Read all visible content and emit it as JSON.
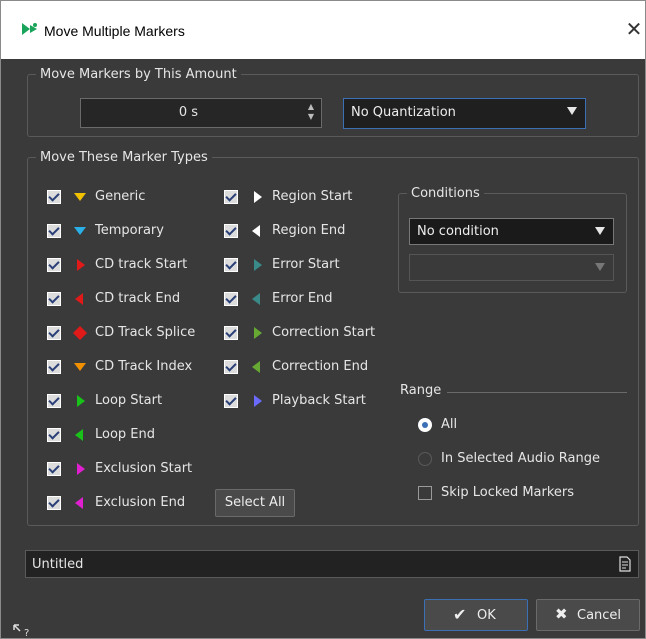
{
  "window": {
    "title": "Move Multiple Markers",
    "close_glyph": "✕"
  },
  "move_amount": {
    "legend": "Move Markers by This Amount",
    "value": "0 s",
    "quantization": "No Quantization"
  },
  "marker_types": {
    "legend": "Move These Marker Types",
    "column1": [
      {
        "label": "Generic",
        "checked": true,
        "icon": "generic-marker-icon",
        "color": "#f2c200"
      },
      {
        "label": "Temporary",
        "checked": true,
        "icon": "temporary-marker-icon",
        "color": "#2ab0e6"
      },
      {
        "label": "CD track Start",
        "checked": true,
        "icon": "cd-track-start-icon",
        "color": "#e01919"
      },
      {
        "label": "CD track End",
        "checked": true,
        "icon": "cd-track-end-icon",
        "color": "#e01919"
      },
      {
        "label": "CD Track Splice",
        "checked": true,
        "icon": "cd-track-splice-icon",
        "color": "#e01919"
      },
      {
        "label": "CD Track Index",
        "checked": true,
        "icon": "cd-track-index-icon",
        "color": "#f29000"
      },
      {
        "label": "Loop Start",
        "checked": true,
        "icon": "loop-start-icon",
        "color": "#19c219"
      },
      {
        "label": "Loop End",
        "checked": true,
        "icon": "loop-end-icon",
        "color": "#19c219"
      },
      {
        "label": "Exclusion Start",
        "checked": true,
        "icon": "exclusion-start-icon",
        "color": "#e020d0"
      },
      {
        "label": "Exclusion End",
        "checked": true,
        "icon": "exclusion-end-icon",
        "color": "#e020d0"
      }
    ],
    "column2": [
      {
        "label": "Region Start",
        "checked": true,
        "icon": "region-start-icon",
        "color": "#ffffff"
      },
      {
        "label": "Region End",
        "checked": true,
        "icon": "region-end-icon",
        "color": "#ffffff"
      },
      {
        "label": "Error Start",
        "checked": true,
        "icon": "error-start-icon",
        "color": "#3a8a8a"
      },
      {
        "label": "Error End",
        "checked": true,
        "icon": "error-end-icon",
        "color": "#3a8a8a"
      },
      {
        "label": "Correction Start",
        "checked": true,
        "icon": "correction-start-icon",
        "color": "#66aa33"
      },
      {
        "label": "Correction End",
        "checked": true,
        "icon": "correction-end-icon",
        "color": "#66aa33"
      },
      {
        "label": "Playback Start",
        "checked": true,
        "icon": "playback-start-icon",
        "color": "#6a6aff"
      }
    ],
    "select_all": "Select All"
  },
  "conditions": {
    "legend": "Conditions",
    "selected": "No condition",
    "secondary": ""
  },
  "range": {
    "label": "Range",
    "options": [
      {
        "label": "All",
        "selected": true
      },
      {
        "label": "In Selected Audio Range",
        "selected": false
      }
    ],
    "skip_locked": {
      "label": "Skip Locked Markers",
      "checked": false
    }
  },
  "preset": {
    "name": "Untitled"
  },
  "buttons": {
    "ok": "OK",
    "cancel": "Cancel"
  },
  "colors": {
    "accent": "#3b6fb6",
    "dialog_bg": "#3a3a3a"
  }
}
